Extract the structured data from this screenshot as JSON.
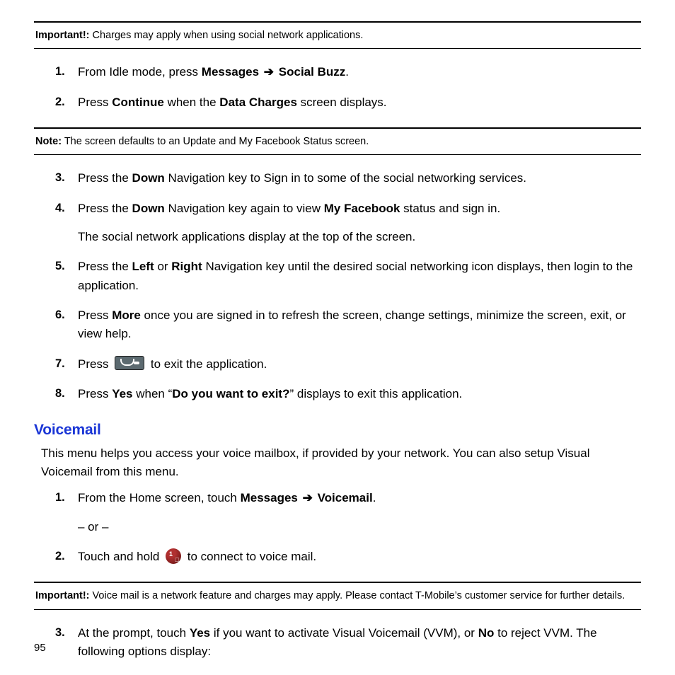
{
  "callout1": {
    "label": "Important!:",
    "text": " Charges may apply when using social network applications."
  },
  "stepsA": {
    "s1": {
      "num": "1.",
      "pre": "From Idle mode, press ",
      "b1": "Messages",
      "arrow": " ➔ ",
      "b2": "Social Buzz",
      "post": "."
    },
    "s2": {
      "num": "2.",
      "pre": "Press ",
      "b1": "Continue",
      "mid": " when the ",
      "b2": "Data Charges",
      "post": " screen displays."
    }
  },
  "callout2": {
    "label": "Note:",
    "text": " The screen defaults to an Update and My Facebook Status screen."
  },
  "stepsB": {
    "s3": {
      "num": "3.",
      "pre": "Press the ",
      "b1": "Down",
      "post": " Navigation key to Sign in to some of the social networking services."
    },
    "s4": {
      "num": "4.",
      "pre": "Press the ",
      "b1": "Down",
      "mid": " Navigation key again to view ",
      "b2": "My Facebook",
      "post": " status and sign in.",
      "sub": "The social network applications display at the top of the screen."
    },
    "s5": {
      "num": "5.",
      "pre": "Press the ",
      "b1": "Left",
      "mid": " or ",
      "b2": "Right",
      "post": " Navigation key until the desired social networking icon displays, then login to the application."
    },
    "s6": {
      "num": "6.",
      "pre": "Press ",
      "b1": "More",
      "post": " once you are signed in to refresh the screen, change settings, minimize the screen, exit, or view help."
    },
    "s7": {
      "num": "7.",
      "pre": "Press ",
      "post": " to exit the application."
    },
    "s8": {
      "num": "8.",
      "pre": "Press ",
      "b1": "Yes",
      "mid": " when “",
      "b2": "Do you want to exit?",
      "post": "” displays to exit this application."
    }
  },
  "section": {
    "title": "Voicemail",
    "intro": "This menu helps you access your voice mailbox, if provided by your network. You can also setup Visual Voicemail from this menu."
  },
  "stepsC": {
    "s1": {
      "num": "1.",
      "pre": "From the Home screen, touch ",
      "b1": "Messages",
      "arrow": " ➔ ",
      "b2": "Voicemail",
      "post": ".",
      "sub": "– or –"
    },
    "s2": {
      "num": "2.",
      "pre": "Touch and hold ",
      "post": " to connect to voice mail."
    }
  },
  "callout3": {
    "label": "Important!:",
    "text": " Voice mail is a network feature and charges may apply. Please contact T-Mobile’s customer service for further details."
  },
  "stepsD": {
    "s3": {
      "num": "3.",
      "pre": "At the prompt, touch ",
      "b1": "Yes",
      "mid": " if you want to activate Visual Voicemail (VVM), or ",
      "b2": "No",
      "post": " to reject VVM. The following options display:"
    }
  },
  "pageNumber": "95"
}
